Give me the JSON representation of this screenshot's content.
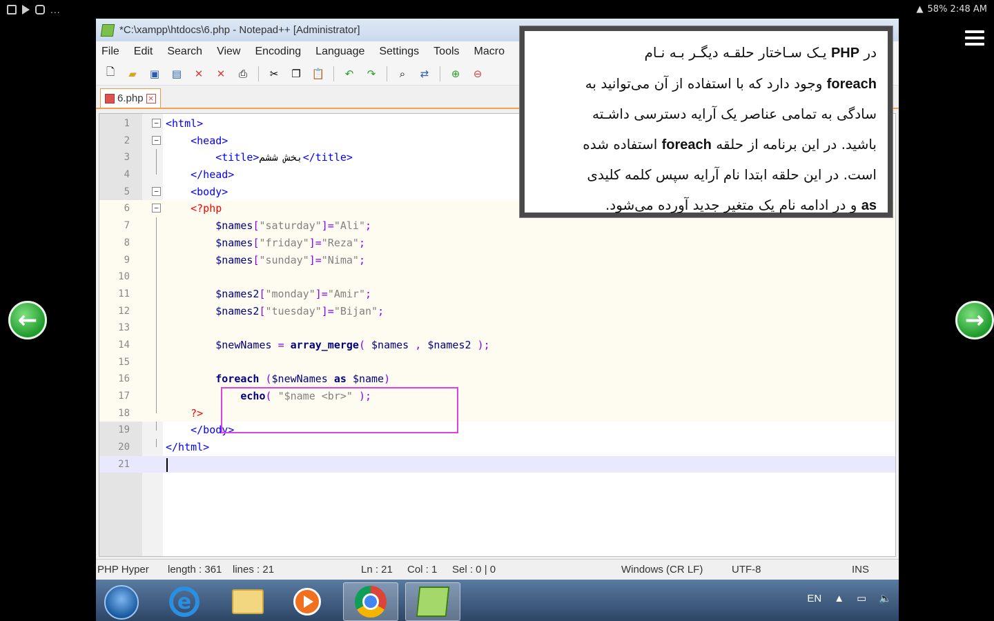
{
  "status_bar": {
    "left_icons": [
      "gallery-icon",
      "play-icon",
      "camera-icon"
    ],
    "more": "...",
    "right": "58% 2:48 AM"
  },
  "window": {
    "title": "*C:\\xampp\\htdocs\\6.php - Notepad++ [Administrator]",
    "menu": [
      "File",
      "Edit",
      "Search",
      "View",
      "Encoding",
      "Language",
      "Settings",
      "Tools",
      "Macro"
    ],
    "tab": {
      "label": "6.php"
    },
    "code_lines": [
      {
        "num": "1",
        "html": "<span class='tag'>&lt;html&gt;</span>",
        "fold": "minus"
      },
      {
        "num": "2",
        "html": "    <span class='tag'>&lt;head&gt;</span>",
        "fold": "minus"
      },
      {
        "num": "3",
        "html": "        <span class='tag'>&lt;title&gt;</span><span class='txt'>بخش ششم</span><span class='tag'>&lt;/title&gt;</span>",
        "fold": "line"
      },
      {
        "num": "4",
        "html": "    <span class='tag'>&lt;/head&gt;</span>",
        "fold": "end"
      },
      {
        "num": "5",
        "html": "    <span class='tag'>&lt;body&gt;</span>",
        "fold": "minus"
      },
      {
        "num": "6",
        "html": "    <span class='php'>&lt;?php</span>",
        "fold": "minus",
        "php": true
      },
      {
        "num": "7",
        "html": "        <span class='var'>$names</span><span class='op'>[</span><span class='str'>\"saturday\"</span><span class='op'>]=</span><span class='str'>\"Ali\"</span><span class='op'>;</span>",
        "fold": "line",
        "php": true
      },
      {
        "num": "8",
        "html": "        <span class='var'>$names</span><span class='op'>[</span><span class='str'>\"friday\"</span><span class='op'>]=</span><span class='str'>\"Reza\"</span><span class='op'>;</span>",
        "fold": "line",
        "php": true
      },
      {
        "num": "9",
        "html": "        <span class='var'>$names</span><span class='op'>[</span><span class='str'>\"sunday\"</span><span class='op'>]=</span><span class='str'>\"Nima\"</span><span class='op'>;</span>",
        "fold": "line",
        "php": true
      },
      {
        "num": "10",
        "html": "",
        "fold": "line",
        "php": true
      },
      {
        "num": "11",
        "html": "        <span class='var'>$names2</span><span class='op'>[</span><span class='str'>\"monday\"</span><span class='op'>]=</span><span class='str'>\"Amir\"</span><span class='op'>;</span>",
        "fold": "line",
        "php": true
      },
      {
        "num": "12",
        "html": "        <span class='var'>$names2</span><span class='op'>[</span><span class='str'>\"tuesday\"</span><span class='op'>]=</span><span class='str'>\"Bijan\"</span><span class='op'>;</span>",
        "fold": "line",
        "php": true
      },
      {
        "num": "13",
        "html": "",
        "fold": "line",
        "php": true
      },
      {
        "num": "14",
        "html": "        <span class='var'>$newNames</span> <span class='op'>=</span> <span class='kw'>array_merge</span><span class='op'>(</span> <span class='var'>$names</span> <span class='op'>,</span> <span class='var'>$names2</span> <span class='op'>);</span>",
        "fold": "line",
        "php": true
      },
      {
        "num": "15",
        "html": "",
        "fold": "line",
        "php": true
      },
      {
        "num": "16",
        "html": "        <span class='kw'>foreach</span> <span class='op'>(</span><span class='var'>$newNames</span> <span class='kw'>as</span> <span class='var'>$name</span><span class='op'>)</span>",
        "fold": "line",
        "php": true
      },
      {
        "num": "17",
        "html": "            <span class='kw'>echo</span><span class='op'>(</span> <span class='str'>\"$name &lt;br&gt;\"</span> <span class='op'>);</span>",
        "fold": "line",
        "php": true
      },
      {
        "num": "18",
        "html": "    <span class='php'>?&gt;</span>",
        "fold": "end",
        "php": true
      },
      {
        "num": "19",
        "html": "    <span class='tag'>&lt;/body&gt;</span>",
        "fold": "end"
      },
      {
        "num": "20",
        "html": "<span class='tag'>&lt;/html&gt;</span>",
        "fold": "end"
      },
      {
        "num": "21",
        "html": "",
        "fold": "none",
        "current": true
      }
    ],
    "statusbar": {
      "lang": "PHP Hyper",
      "length": "length : 361",
      "lines": "lines : 21",
      "ln": "Ln : 21",
      "col": "Col : 1",
      "sel": "Sel : 0 | 0",
      "eol": "Windows (CR LF)",
      "encoding": "UTF-8",
      "mode": "INS"
    }
  },
  "taskbar": {
    "lang": "EN"
  },
  "note": {
    "lines": [
      "در <b>PHP</b> یـک سـاختار حلقـه دیگـر بـه نـام",
      "<b>foreach</b> وجود دارد که با استفاده از آن می‌توانید به",
      "سادگی به تمامی عناصر یک آرایه دسترسی داشـته",
      "باشید. در این برنامه از حلقه <b>foreach</b> استفاده شده",
      "است. در این حلقه ابتدا نام آرایه سپس کلمه کلیدی",
      "<b>as</b> و در ادامه نام یک متغیر جدید آورده می‌شود."
    ]
  }
}
